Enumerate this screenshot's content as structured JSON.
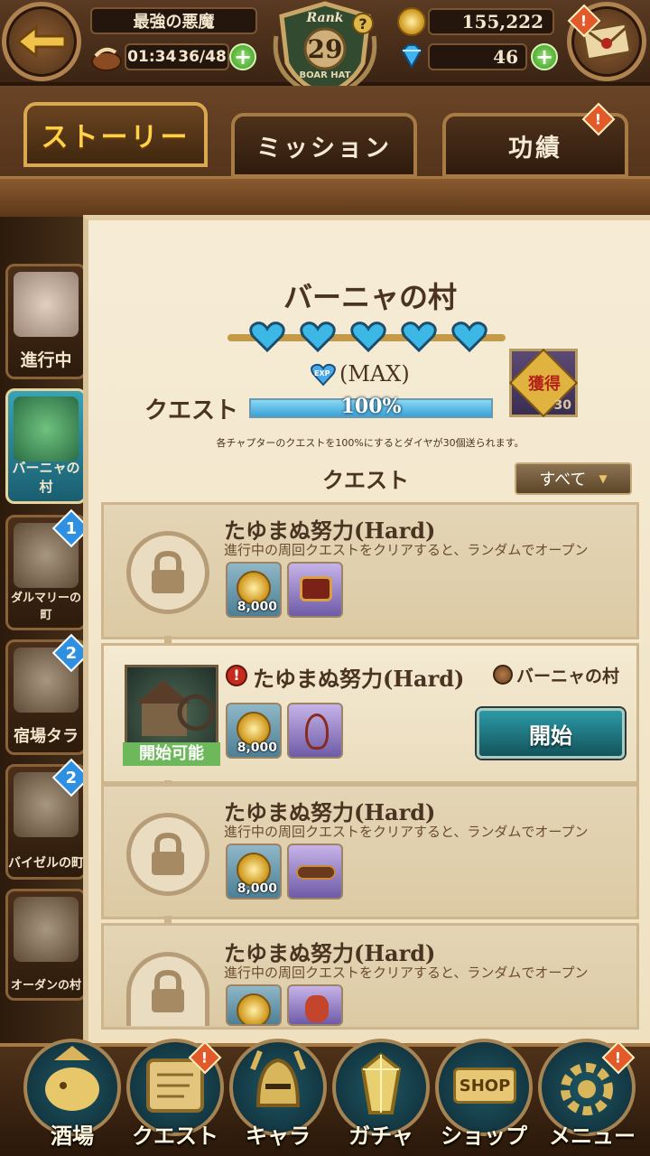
{
  "header": {
    "player_name": "最強の悪魔",
    "timer": "01:34",
    "stamina": "36/48",
    "rank_label": "Rank",
    "rank_value": "29",
    "rank_emblem_text": "BOAR HAT",
    "gold": "155,222",
    "diamonds": "46"
  },
  "tabs": [
    {
      "label": "ストーリー",
      "active": true
    },
    {
      "label": "ミッション",
      "active": false
    },
    {
      "label": "功績",
      "active": false,
      "alert": true
    }
  ],
  "sidebar": [
    {
      "label": "進行中",
      "active": false,
      "badge": null
    },
    {
      "label": "バーニャの村",
      "active": true,
      "badge": null
    },
    {
      "label": "ダルマリーの町",
      "active": false,
      "badge": "1"
    },
    {
      "label": "宿場タラ",
      "active": false,
      "badge": "2"
    },
    {
      "label": "バイゼルの町",
      "active": false,
      "badge": "2"
    },
    {
      "label": "オーダンの村",
      "active": false,
      "badge": null
    }
  ],
  "chapter": {
    "title": "バーニャの村",
    "hearts_filled": 5,
    "hearts_total": 5,
    "exp_badge": "EXP",
    "max_label": "(MAX)",
    "quest_label": "クエスト",
    "progress_text": "100%",
    "progress_value": 1.0,
    "reward_label": "獲得",
    "reward_count": "30",
    "note": "各チャプターのクエストを100%にするとダイヤが30個送られます。",
    "quest_section_label": "クエスト",
    "filter_label": "すべて"
  },
  "quests": [
    {
      "state": "locked",
      "title": "たゆまぬ努力(Hard)",
      "desc": "進行中の周回クエストをクリアすると、ランダムでオープン",
      "coin_qty": "8,000"
    },
    {
      "state": "open",
      "title": "たゆまぬ努力(Hard)",
      "location": "バーニャの村",
      "status_label": "開始可能",
      "start_label": "開始",
      "coin_qty": "8,000"
    },
    {
      "state": "locked",
      "title": "たゆまぬ努力(Hard)",
      "desc": "進行中の周回クエストをクリアすると、ランダムでオープン",
      "coin_qty": "8,000"
    },
    {
      "state": "locked",
      "title": "たゆまぬ努力(Hard)",
      "desc": "進行中の周回クエストをクリアすると、ランダムでオープン",
      "coin_qty": ""
    }
  ],
  "bottom_nav": [
    {
      "label": "酒場",
      "alert": false
    },
    {
      "label": "クエスト",
      "alert": true
    },
    {
      "label": "キャラ",
      "alert": false
    },
    {
      "label": "ガチャ",
      "alert": false
    },
    {
      "label": "ショップ",
      "alert": false,
      "shop_sign": "SHOP"
    },
    {
      "label": "メニュー",
      "alert": true
    }
  ],
  "colors": {
    "accent_gold": "#ffd24a",
    "teal_button": "#1f7580",
    "alert_orange": "#e35a2a",
    "badge_blue": "#2f8fe0"
  }
}
